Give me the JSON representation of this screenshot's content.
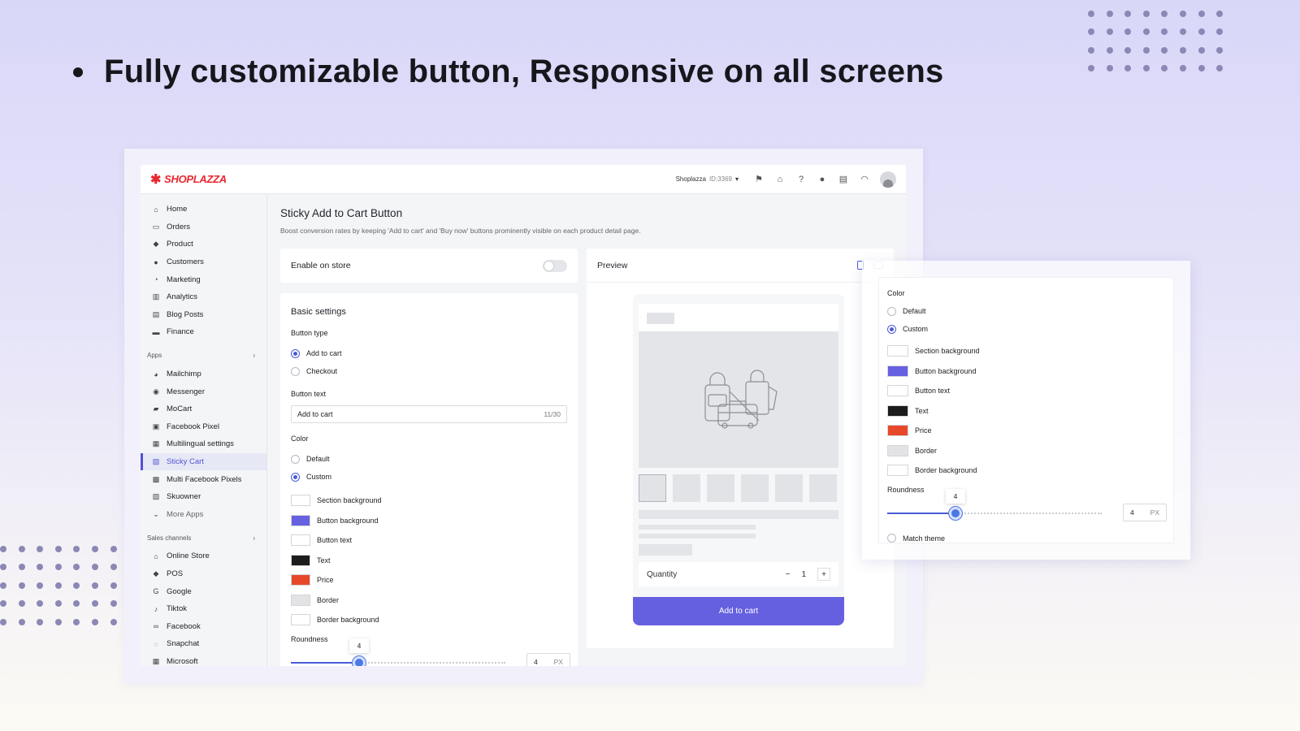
{
  "headline": "Fully customizable button, Responsive on all screens",
  "brand": {
    "logo_text": "SHOPLAZZA",
    "accent": "#e8272f"
  },
  "topbar": {
    "store_name": "Shoplazza",
    "store_id": "ID:3369"
  },
  "sidebar": {
    "items": [
      {
        "label": "Home",
        "icon": "home-icon",
        "glyph": "⌂"
      },
      {
        "label": "Orders",
        "icon": "orders-icon",
        "glyph": "▭"
      },
      {
        "label": "Product",
        "icon": "tag-icon",
        "glyph": "◆"
      },
      {
        "label": "Customers",
        "icon": "person-icon",
        "glyph": "●"
      },
      {
        "label": "Marketing",
        "icon": "marketing-icon",
        "glyph": "◔"
      },
      {
        "label": "Analytics",
        "icon": "bar-chart-icon",
        "glyph": "▥"
      },
      {
        "label": "Blog Posts",
        "icon": "blog-icon",
        "glyph": "▤"
      },
      {
        "label": "Finance",
        "icon": "finance-icon",
        "glyph": "▬"
      }
    ],
    "apps_heading": "Apps",
    "apps": [
      {
        "label": "Mailchimp",
        "icon": "mailchimp-icon",
        "glyph": "◕",
        "active": false
      },
      {
        "label": "Messenger",
        "icon": "messenger-icon",
        "glyph": "◉",
        "active": false
      },
      {
        "label": "MoCart",
        "icon": "mocart-icon",
        "glyph": "▰",
        "active": false
      },
      {
        "label": "Facebook Pixel",
        "icon": "facebook-pixel-icon",
        "glyph": "▣",
        "active": false
      },
      {
        "label": "Multilingual settings",
        "icon": "multilingual-icon",
        "glyph": "▦",
        "active": false
      },
      {
        "label": "Sticky Cart",
        "icon": "cart-icon",
        "glyph": "▧",
        "active": true
      },
      {
        "label": "Multi Facebook Pixels",
        "icon": "pixels-icon",
        "glyph": "▩",
        "active": false
      },
      {
        "label": "Skuowner",
        "icon": "skuowner-icon",
        "glyph": "▨",
        "active": false
      }
    ],
    "more_apps": "More Apps",
    "sales_heading": "Sales channels",
    "sales": [
      {
        "label": "Online Store",
        "icon": "store-icon",
        "glyph": "⌂"
      },
      {
        "label": "POS",
        "icon": "pos-icon",
        "glyph": "◆"
      },
      {
        "label": "Google",
        "icon": "google-icon",
        "glyph": "G"
      },
      {
        "label": "Tiktok",
        "icon": "tiktok-icon",
        "glyph": "♪"
      },
      {
        "label": "Facebook",
        "icon": "facebook-icon",
        "glyph": "∞"
      },
      {
        "label": "Snapchat",
        "icon": "snapchat-icon",
        "glyph": "◌"
      },
      {
        "label": "Microsoft",
        "icon": "microsoft-icon",
        "glyph": "▦"
      }
    ]
  },
  "page": {
    "title": "Sticky Add to Cart Button",
    "subtitle": "Boost conversion rates by keeping 'Add to cart' and 'Buy now' buttons prominently visible on each product detail page."
  },
  "enable": {
    "label": "Enable on store",
    "on": false
  },
  "basic": {
    "title": "Basic settings",
    "button_type_label": "Button type",
    "button_types": [
      {
        "label": "Add to cart",
        "checked": true
      },
      {
        "label": "Checkout",
        "checked": false
      }
    ],
    "button_text_label": "Button text",
    "button_text_value": "Add to cart",
    "button_text_count": "11/30"
  },
  "color": {
    "label": "Color",
    "modes": [
      {
        "label": "Default",
        "checked": false
      },
      {
        "label": "Custom",
        "checked": true
      }
    ],
    "swatches": [
      {
        "label": "Section background",
        "color": "#ffffff"
      },
      {
        "label": "Button background",
        "color": "#6760e0"
      },
      {
        "label": "Button text",
        "color": "#ffffff"
      },
      {
        "label": "Text",
        "color": "#1c1c1c"
      },
      {
        "label": "Price",
        "color": "#e8482a"
      },
      {
        "label": "Border",
        "color": "#e3e3e5"
      },
      {
        "label": "Border background",
        "color": "#ffffff"
      }
    ],
    "roundness_label": "Roundness",
    "roundness_value": "4",
    "roundness_fraction": 0.32,
    "roundness_unit": "PX",
    "match_theme": "Match theme"
  },
  "preview": {
    "title": "Preview",
    "quantity_label": "Quantity",
    "quantity_value": "1",
    "minus": "−",
    "plus": "+",
    "button_label": "Add to cart",
    "button_color": "#6560e0"
  }
}
